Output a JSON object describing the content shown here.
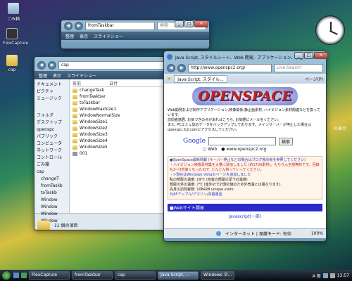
{
  "desktop": {
    "icons": [
      {
        "label": "ごみ箱"
      },
      {
        "label": "FlexCapture"
      },
      {
        "label": "cap"
      }
    ],
    "right_label": "の表示"
  },
  "explorer_back": {
    "title": "fromTaskbar",
    "search_placeholder": "検索",
    "cmd": [
      "整理",
      "表示",
      "スライドショー"
    ]
  },
  "explorer": {
    "path": "cap",
    "search_placeholder": "検索",
    "cmd": [
      "整理",
      "表示",
      "スライドショー"
    ],
    "favorites": [
      "ドキュメント",
      "ピクチャ",
      "ミュージック"
    ],
    "folder_header": "フォルダ",
    "tree": [
      "デスクトップ",
      "openspc",
      "パブリック",
      "コンピュータ",
      "ネットワーク",
      "コントロール",
      "ごみ箱",
      "cap",
      "changeT",
      "fromTaskb",
      "toTaskb",
      "Window",
      "Window",
      "Window",
      "Window"
    ],
    "column_name": "名前",
    "column_date": "日付",
    "files": [
      "changeTask",
      "fromTaskbar",
      "toTaskbar",
      "WindowMaxSize1",
      "WindowNormalSize",
      "WindowSize1",
      "WindowSize2",
      "WindowSize3",
      "WindowSize4",
      "WindowSize5",
      "001"
    ],
    "status": "11 個の項目"
  },
  "ie": {
    "title": "Java Script, スタイルシート、Web 開発、アプリケーション、学習サイト - Op",
    "url": "http://www.openspc2.org/",
    "search_placeholder": "Live Search",
    "tab": "Java Script, スタイル...",
    "page_menu": "ページ(P)",
    "logo": "OPENSPACE",
    "intro": [
      "Web開発および制作アプリケーション,映像関係,静止画素材, ハイビジョン素材関連などを扱っています。",
      "訪問者諸君, お気づきの点があればこちら, お気軽にメールをください。",
      "また, PCエミュ誌のデータをバックアップしております。メインサーバーが停止した場合はopenspc.fc2.comにアクセスしてください。"
    ],
    "google_button": "検索",
    "radio_web": "Web",
    "radio_site": "www.openspc2.org",
    "news": [
      "●OpenSpace最新情報 (サーバー停止などの場合はブログ掲示板を参照してください)",
      "・ハイビジョン映像素材集を大量に追加しました (約1700素材)。もちろん全部無料です。回線も2〜3倍速くなったので, どんどん持っていってください。",
      "・>現在はWindows Vistaのページを追加しました",
      "私の部屋の温度: 19℃ (自室の部屋の足下の温度)",
      "部屋の外の温度: 7℃ (室外計で計測の値のため外気温とは異なります)",
      "先月の訪問者数: 108428 unique visits",
      "元AFアップル/アマゾン/青春書店"
    ],
    "section_bar": "■Webサイト開発",
    "section_link": "Javascript(一部)",
    "status_zone": "インターネット | 保護モード: 有効",
    "zoom": "100%"
  },
  "taskbar": {
    "buttons": [
      "FlexCapture",
      "fromTaskbar",
      "cap",
      "Java Script, ...",
      "Windows タ..."
    ],
    "lang": "A 般",
    "time": "13:57"
  }
}
